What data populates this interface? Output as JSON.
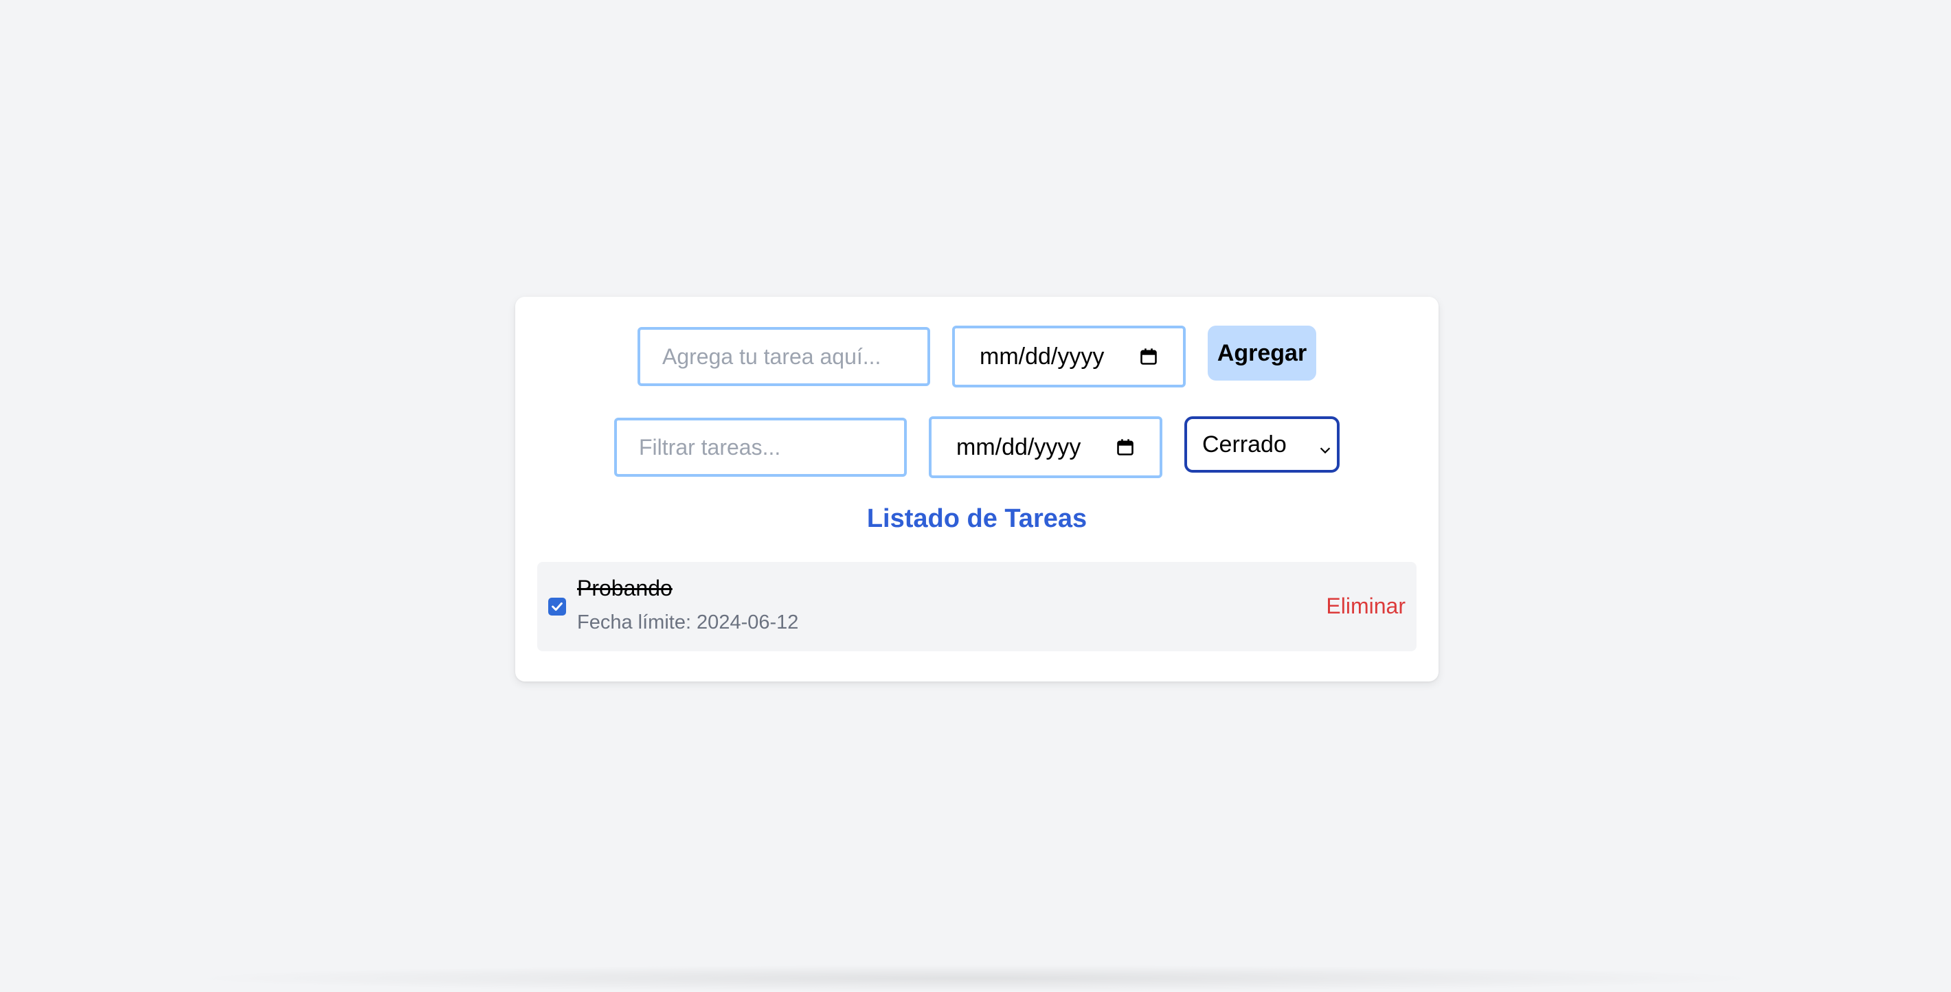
{
  "form": {
    "task_placeholder": "Agrega tu tarea aquí...",
    "date_placeholder": "mm/dd/yyyy",
    "add_label": "Agregar"
  },
  "filters": {
    "filter_placeholder": "Filtrar tareas...",
    "date_placeholder": "mm/dd/yyyy",
    "status_selected": "Cerrado"
  },
  "list": {
    "title": "Listado de Tareas",
    "tasks": [
      {
        "name": "Probando",
        "due_label": "Fecha límite: 2024-06-12",
        "completed": true,
        "delete_label": "Eliminar"
      }
    ]
  },
  "colors": {
    "accent": "#2f5fd6",
    "input_border": "#93c5fd",
    "button_bg": "#bfdbfe",
    "delete": "#dc3b3b",
    "select_border": "#1e40af"
  }
}
